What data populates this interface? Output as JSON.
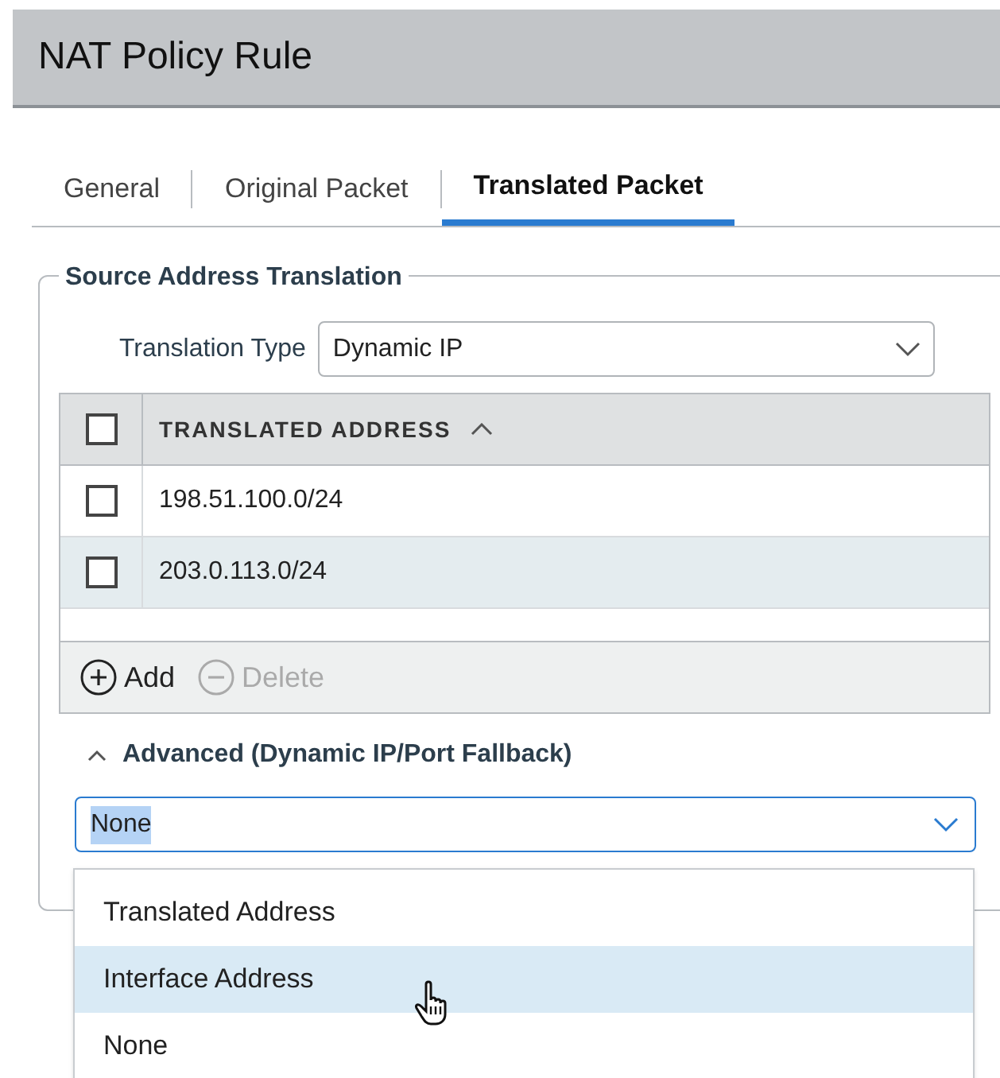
{
  "window": {
    "title": "NAT Policy Rule"
  },
  "tabs": [
    {
      "label": "General",
      "selected": false
    },
    {
      "label": "Original Packet",
      "selected": false
    },
    {
      "label": "Translated Packet",
      "selected": true
    }
  ],
  "section": {
    "legend": "Source Address Translation",
    "translation_type": {
      "label": "Translation Type",
      "value": "Dynamic IP"
    },
    "table": {
      "header_checked": false,
      "column": "TRANSLATED ADDRESS",
      "rows": [
        {
          "address": "198.51.100.0/24",
          "checked": false,
          "highlighted": false
        },
        {
          "address": "203.0.113.0/24",
          "checked": false,
          "highlighted": true
        }
      ]
    },
    "actions": [
      {
        "label": "Add",
        "disabled": false,
        "kind": "add"
      },
      {
        "label": "Delete",
        "disabled": true,
        "kind": "delete"
      }
    ],
    "advanced": {
      "label": "Advanced (Dynamic IP/Port Fallback)",
      "expanded": true,
      "value": "None",
      "options": [
        {
          "label": "Translated Address",
          "highlighted": false
        },
        {
          "label": "Interface Address",
          "highlighted": true
        },
        {
          "label": "None",
          "highlighted": false
        }
      ]
    }
  }
}
